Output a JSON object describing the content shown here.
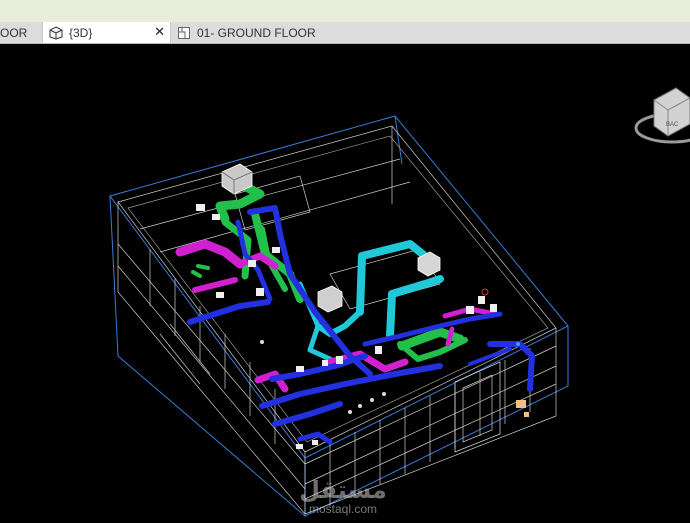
{
  "tabs": [
    {
      "label": "OOR",
      "icon": "none"
    },
    {
      "label": "{3D}",
      "icon": "house-3d-icon",
      "active": true
    },
    {
      "label": "01- GROUND FLOOR",
      "icon": "floor-plan-icon"
    }
  ],
  "close_glyph": "✕",
  "viewcube": {
    "label": "BAC"
  },
  "watermark": {
    "arabic": "مستقل",
    "latin": "mostaql.com"
  },
  "colors": {
    "background": "#000000",
    "tab_bar": "#dcdcdc",
    "active_tab": "#ffffff",
    "top_strip": "#e9eddc",
    "building_lines": "#d8d8d8",
    "bounding_box": "#3a7bd5",
    "supply_duct": "#22c04a",
    "return_duct": "#d020d0",
    "exhaust_duct": "#2230e0",
    "fresh_air_duct": "#20c8d8"
  }
}
